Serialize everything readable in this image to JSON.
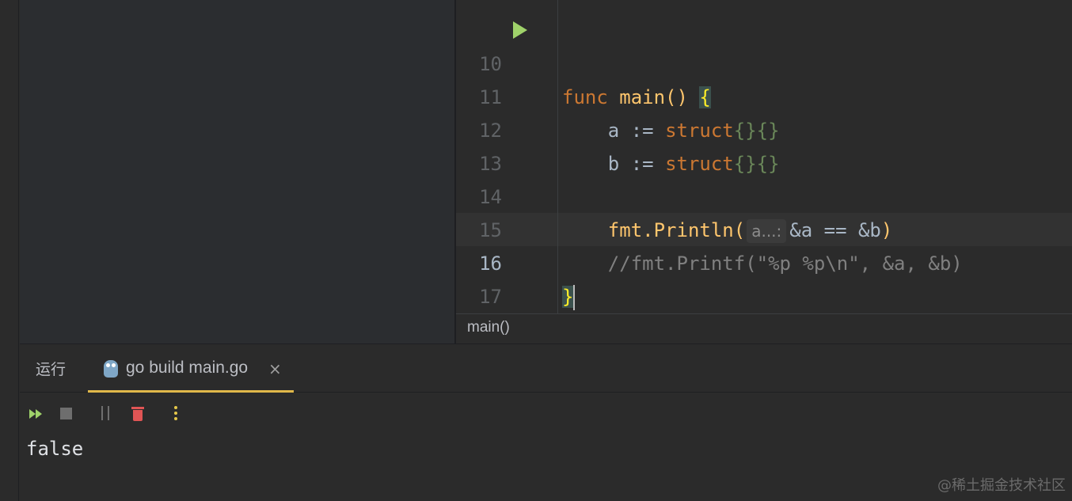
{
  "editor": {
    "lines": [
      {
        "num": "10"
      },
      {
        "num": "11"
      },
      {
        "num": "12"
      },
      {
        "num": "13"
      },
      {
        "num": "14"
      },
      {
        "num": "15"
      },
      {
        "num": "16"
      },
      {
        "num": "17"
      }
    ],
    "code": {
      "l10_kw": "func",
      "l10_fn": "main",
      "l10_parens": "()",
      "l10_brace": "{",
      "l11_var": "a",
      "l11_op": ":=",
      "l11_kw": "struct",
      "l11_braces": "{}{}",
      "l12_var": "b",
      "l12_op": ":=",
      "l12_kw": "struct",
      "l12_braces": "{}{}",
      "l14_pkg": "fmt.",
      "l14_fn": "Println",
      "l14_open": "(",
      "l14_hint": "a...:",
      "l14_args": "&a == &b",
      "l14_close": ")",
      "l15_comment": "//fmt.Printf(\"%p %p\\n\", &a, &b)",
      "l16_brace": "}"
    },
    "breadcrumb": "main()"
  },
  "run_panel": {
    "title": "运行",
    "tab_label": "go build main.go",
    "tab_close": "×",
    "output": "false"
  },
  "icons": {
    "run_gutter": "run-triangle-icon",
    "tab": "gopher-icon",
    "toolbar": [
      "rerun-icon",
      "stop-icon",
      "scroll-to-end-icon",
      "trash-icon",
      "more-vertical-icon"
    ]
  },
  "colors": {
    "run_green": "#9fd26a",
    "active_tab_underline": "#e0b84a",
    "trash_red": "#e05555"
  },
  "watermark": "@稀土掘金技术社区"
}
